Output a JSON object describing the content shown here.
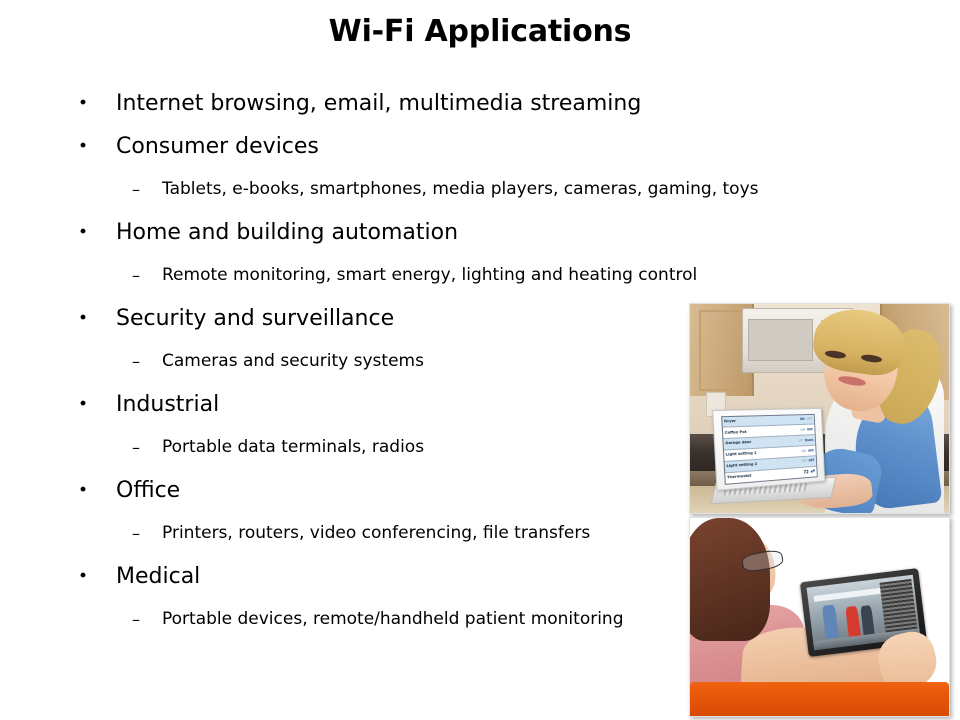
{
  "slide": {
    "title": "Wi-Fi Applications",
    "bullets": [
      {
        "level": 1,
        "marker": "•",
        "text": "Internet browsing, email, multimedia streaming"
      },
      {
        "level": 1,
        "marker": "•",
        "text": "Consumer devices"
      },
      {
        "level": 2,
        "marker": "–",
        "text": "Tablets, e-books, smartphones, media players, cameras, gaming, toys"
      },
      {
        "level": 1,
        "marker": "•",
        "text": "Home and building automation"
      },
      {
        "level": 2,
        "marker": "–",
        "text": "Remote monitoring, smart energy, lighting and heating control"
      },
      {
        "level": 1,
        "marker": "•",
        "text": "Security and surveillance"
      },
      {
        "level": 2,
        "marker": "–",
        "text": "Cameras and security systems"
      },
      {
        "level": 1,
        "marker": "•",
        "text": "Industrial"
      },
      {
        "level": 2,
        "marker": "–",
        "text": "Portable data terminals, radios"
      },
      {
        "level": 1,
        "marker": "•",
        "text": "Office"
      },
      {
        "level": 2,
        "marker": "–",
        "text": "Printers, routers, video conferencing, file transfers"
      },
      {
        "level": 1,
        "marker": "•",
        "text": "Medical"
      },
      {
        "level": 2,
        "marker": "–",
        "text": "Portable devices, remote/handheld patient monitoring"
      }
    ]
  },
  "photos": {
    "kitchen": {
      "caption": "Smiling woman at kitchen counter using a laptop home-automation control panel",
      "control_panel": {
        "rows": [
          {
            "name": "Dryer",
            "options": [
              "ON",
              "OFF"
            ],
            "selected": "ON"
          },
          {
            "name": "Coffee Pot",
            "options": [
              "ON",
              "OFF"
            ],
            "selected": "OFF"
          },
          {
            "name": "Garage door",
            "options": [
              "UP",
              "Down"
            ],
            "selected": "Down"
          },
          {
            "name": "Light setting 1",
            "options": [
              "ON",
              "OFF"
            ],
            "selected": "OFF"
          },
          {
            "name": "Light setting 2",
            "options": [
              "ON",
              "OFF"
            ],
            "selected": "OFF"
          },
          {
            "name": "Thermostat",
            "value": "72",
            "arrows": "▲▼"
          }
        ]
      }
    },
    "tablet": {
      "caption": "Woman wearing glasses viewing video on a tablet at an orange table"
    }
  },
  "colors": {
    "title": "#000000",
    "body_text": "#000000",
    "background": "#ffffff",
    "panel_row_highlight": "#cfe3f2",
    "panel_accent": "#2e6fb7",
    "table_orange": "#e8560a"
  }
}
